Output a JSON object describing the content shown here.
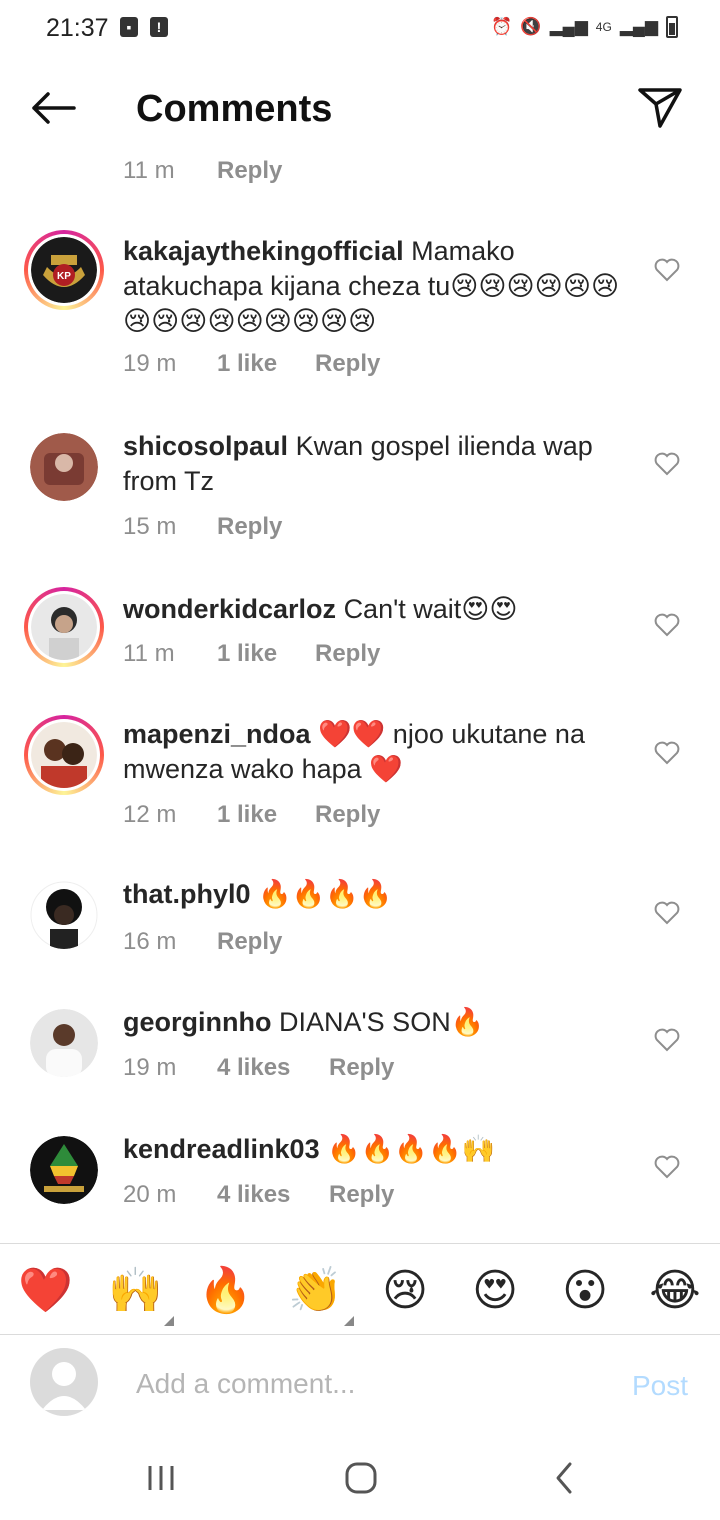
{
  "status_bar": {
    "time": "21:37",
    "network": "4G"
  },
  "header": {
    "title": "Comments"
  },
  "top_meta": {
    "time": "11 m",
    "reply": "Reply"
  },
  "comments": [
    {
      "username": "kakajaythekingofficial",
      "text": "Mamako atakuchapa kijana cheza tu😢😢😢😢😢😢😢😢😢😢😢😢😢😢😢",
      "time": "19 m",
      "likes": "1 like",
      "reply": "Reply"
    },
    {
      "username": "shicosolpaul",
      "text": "Kwan gospel ilienda wap from Tz",
      "time": "15 m",
      "likes": "",
      "reply": "Reply"
    },
    {
      "username": "wonderkidcarloz",
      "text": "Can't wait😍😍",
      "time": "11 m",
      "likes": "1 like",
      "reply": "Reply"
    },
    {
      "username": "mapenzi_ndoa",
      "text": "❤️❤️ njoo ukutane na mwenza wako hapa ❤️",
      "time": "12 m",
      "likes": "1 like",
      "reply": "Reply"
    },
    {
      "username": "that.phyl0",
      "text": "🔥🔥🔥🔥",
      "time": "16 m",
      "likes": "",
      "reply": "Reply"
    },
    {
      "username": "georginnho",
      "text": "DIANA'S SON🔥",
      "time": "19 m",
      "likes": "4 likes",
      "reply": "Reply"
    },
    {
      "username": "kendreadlink03",
      "text": "🔥🔥🔥🔥🙌",
      "time": "20 m",
      "likes": "4 likes",
      "reply": "Reply"
    }
  ],
  "emoji_bar": [
    "❤️",
    "🙌",
    "🔥",
    "👏",
    "😢",
    "😍",
    "😮",
    "😂"
  ],
  "composer": {
    "placeholder": "Add a comment...",
    "post_label": "Post"
  },
  "colors": {
    "post_disabled": "#b3dbff",
    "meta_gray": "#8e8e8e",
    "ring_gradient_start": "#d6249f",
    "ring_gradient_end": "#fdf497"
  }
}
